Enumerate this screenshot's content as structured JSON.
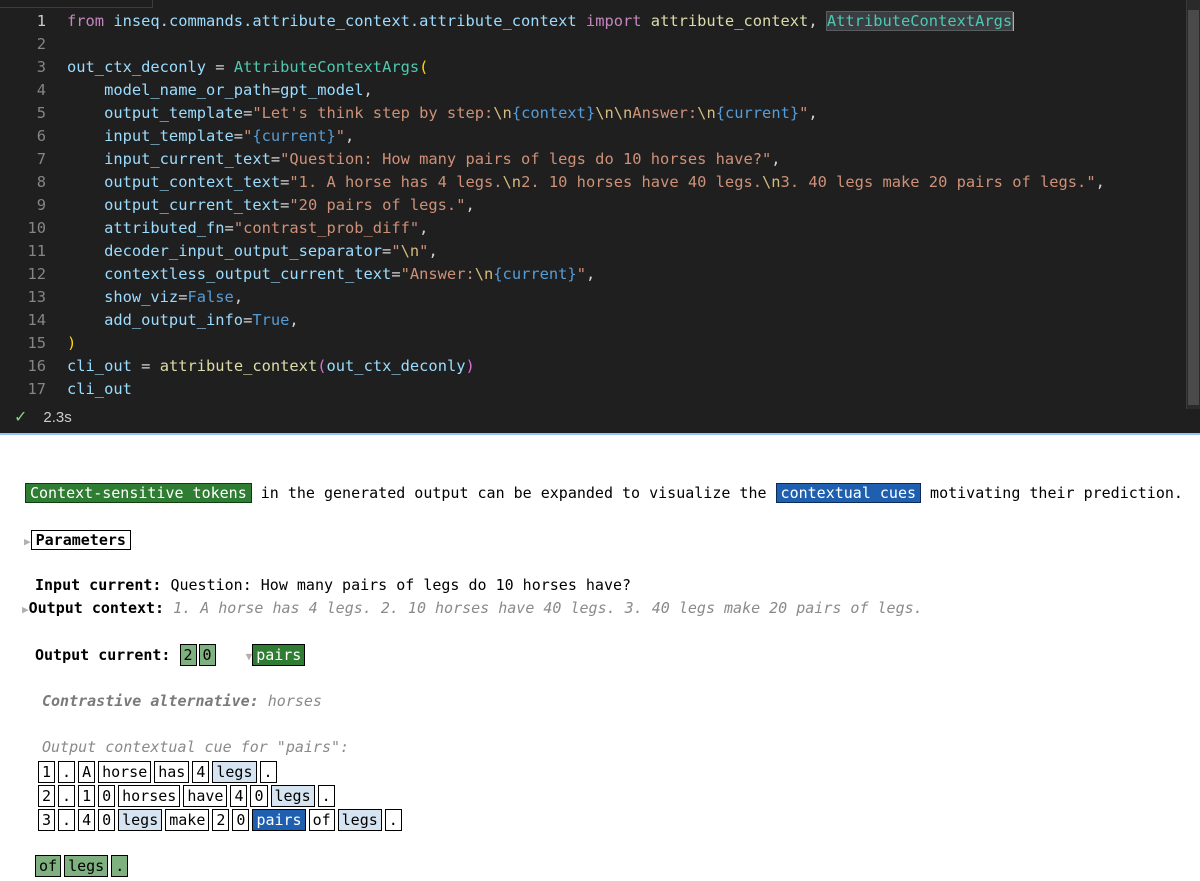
{
  "editor": {
    "lines": [
      {
        "n": "1",
        "segments": [
          [
            "kw",
            "from "
          ],
          [
            "mod",
            "inseq.commands.attribute_context.attribute_context "
          ],
          [
            "kw",
            "import "
          ],
          [
            "fn",
            "attribute_context"
          ],
          [
            "op",
            ", "
          ],
          [
            "clshl",
            "AttributeContextArgs"
          ]
        ]
      },
      {
        "n": "2",
        "segments": []
      },
      {
        "n": "3",
        "segments": [
          [
            "var",
            "out_ctx_deconly "
          ],
          [
            "op",
            "= "
          ],
          [
            "cls",
            "AttributeContextArgs"
          ],
          [
            "p1",
            "("
          ]
        ]
      },
      {
        "n": "4",
        "segments": [
          [
            "var",
            "    model_name_or_path"
          ],
          [
            "op",
            "="
          ],
          [
            "var",
            "gpt_model"
          ],
          [
            "op",
            ","
          ]
        ]
      },
      {
        "n": "5",
        "segments": [
          [
            "var",
            "    output_template"
          ],
          [
            "op",
            "="
          ],
          [
            "str",
            "\"Let's think step by step:"
          ],
          [
            "esc",
            "\\n"
          ],
          [
            "ph",
            "{context}"
          ],
          [
            "esc",
            "\\n\\n"
          ],
          [
            "str",
            "Answer:"
          ],
          [
            "esc",
            "\\n"
          ],
          [
            "ph",
            "{current}"
          ],
          [
            "str",
            "\""
          ],
          [
            "op",
            ","
          ]
        ]
      },
      {
        "n": "6",
        "segments": [
          [
            "var",
            "    input_template"
          ],
          [
            "op",
            "="
          ],
          [
            "str",
            "\""
          ],
          [
            "ph",
            "{current}"
          ],
          [
            "str",
            "\""
          ],
          [
            "op",
            ","
          ]
        ]
      },
      {
        "n": "7",
        "segments": [
          [
            "var",
            "    input_current_text"
          ],
          [
            "op",
            "="
          ],
          [
            "str",
            "\"Question: How many pairs of legs do 10 horses have?\""
          ],
          [
            "op",
            ","
          ]
        ]
      },
      {
        "n": "8",
        "segments": [
          [
            "var",
            "    output_context_text"
          ],
          [
            "op",
            "="
          ],
          [
            "str",
            "\"1. A horse has 4 legs."
          ],
          [
            "esc",
            "\\n"
          ],
          [
            "str",
            "2. 10 horses have 40 legs."
          ],
          [
            "esc",
            "\\n"
          ],
          [
            "str",
            "3. 40 legs make 20 pairs of legs.\""
          ],
          [
            "op",
            ","
          ]
        ]
      },
      {
        "n": "9",
        "segments": [
          [
            "var",
            "    output_current_text"
          ],
          [
            "op",
            "="
          ],
          [
            "str",
            "\"20 pairs of legs.\""
          ],
          [
            "op",
            ","
          ]
        ]
      },
      {
        "n": "10",
        "segments": [
          [
            "var",
            "    attributed_fn"
          ],
          [
            "op",
            "="
          ],
          [
            "str",
            "\"contrast_prob_diff\""
          ],
          [
            "op",
            ","
          ]
        ]
      },
      {
        "n": "11",
        "segments": [
          [
            "var",
            "    decoder_input_output_separator"
          ],
          [
            "op",
            "="
          ],
          [
            "str",
            "\""
          ],
          [
            "esc",
            "\\n"
          ],
          [
            "str",
            "\""
          ],
          [
            "op",
            ","
          ]
        ]
      },
      {
        "n": "12",
        "segments": [
          [
            "var",
            "    contextless_output_current_text"
          ],
          [
            "op",
            "="
          ],
          [
            "str",
            "\"Answer:"
          ],
          [
            "esc",
            "\\n"
          ],
          [
            "ph",
            "{current}"
          ],
          [
            "str",
            "\""
          ],
          [
            "op",
            ","
          ]
        ]
      },
      {
        "n": "13",
        "segments": [
          [
            "var",
            "    show_viz"
          ],
          [
            "op",
            "="
          ],
          [
            "bool",
            "False"
          ],
          [
            "op",
            ","
          ]
        ]
      },
      {
        "n": "14",
        "segments": [
          [
            "var",
            "    add_output_info"
          ],
          [
            "op",
            "="
          ],
          [
            "bool",
            "True"
          ],
          [
            "op",
            ","
          ]
        ]
      },
      {
        "n": "15",
        "segments": [
          [
            "p1",
            ")"
          ]
        ]
      },
      {
        "n": "16",
        "segments": [
          [
            "var",
            "cli_out "
          ],
          [
            "op",
            "= "
          ],
          [
            "fn",
            "attribute_context"
          ],
          [
            "p2",
            "("
          ],
          [
            "var",
            "out_ctx_deconly"
          ],
          [
            "p2",
            ")"
          ]
        ]
      },
      {
        "n": "17",
        "segments": [
          [
            "var",
            "cli_out"
          ]
        ]
      }
    ],
    "exec_time": "2.3s",
    "status_icon": "check-icon"
  },
  "output": {
    "intro": {
      "tag1": "Context-sensitive tokens",
      "mid": " in the generated output can be expanded to visualize the ",
      "tag2": "contextual cues",
      "end": " motivating their prediction."
    },
    "params_label": "Parameters",
    "input_current_label": "Input current:",
    "input_current_value": " Question: How many pairs of legs do 10 horses have?",
    "output_context_label": "Output context:",
    "output_context_value": " 1. A horse has 4 legs. 2. 10 horses have 40 legs. 3. 40 legs make 20 pairs of legs.",
    "output_current_label": "Output current:",
    "output_current_tokens": [
      "2",
      "0"
    ],
    "output_current_expanded": "pairs",
    "contrastive_label": "Contrastive alternative:",
    "contrastive_value": " horses",
    "cue_label": "Output contextual cue for \"pairs\":",
    "cue_rows": [
      [
        [
          "1",
          "none"
        ],
        [
          ".",
          "none"
        ],
        [
          "A",
          "none"
        ],
        [
          "horse",
          "none"
        ],
        [
          "has",
          "none"
        ],
        [
          "4",
          "none"
        ],
        [
          "legs",
          "lt"
        ],
        [
          ".",
          "none"
        ]
      ],
      [
        [
          "2",
          "none"
        ],
        [
          ".",
          "none"
        ],
        [
          "1",
          "none"
        ],
        [
          "0",
          "none"
        ],
        [
          "horses",
          "none"
        ],
        [
          "have",
          "none"
        ],
        [
          "4",
          "none"
        ],
        [
          "0",
          "none"
        ],
        [
          "legs",
          "lt"
        ],
        [
          ".",
          "none"
        ]
      ],
      [
        [
          "3",
          "none"
        ],
        [
          ".",
          "none"
        ],
        [
          "4",
          "none"
        ],
        [
          "0",
          "none"
        ],
        [
          "legs",
          "lt"
        ],
        [
          "make",
          "none"
        ],
        [
          "2",
          "none"
        ],
        [
          "0",
          "none"
        ],
        [
          "pairs",
          "dk"
        ],
        [
          "of",
          "none"
        ],
        [
          "legs",
          "lt"
        ],
        [
          ".",
          "none"
        ]
      ]
    ],
    "trailing_tokens": [
      [
        "of",
        "lg"
      ],
      [
        "legs",
        "lg"
      ],
      [
        ".",
        "lg"
      ]
    ]
  }
}
